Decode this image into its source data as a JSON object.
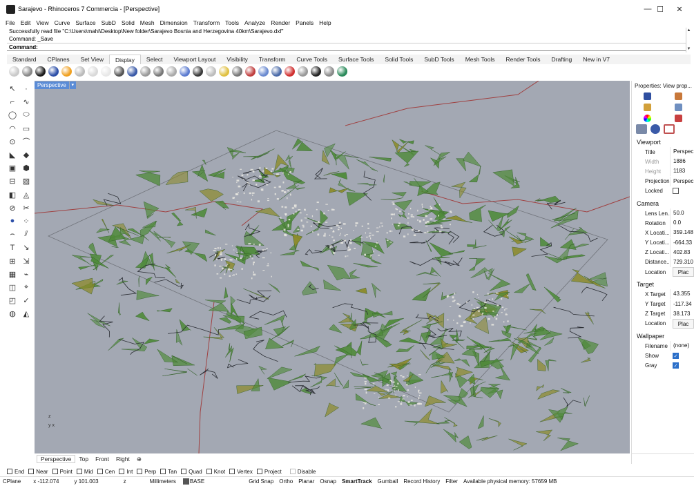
{
  "window": {
    "title": "Sarajevo - Rhinoceros 7 Commercia - [Perspective]",
    "minimize": "—",
    "maximize": "☐",
    "close": "✕"
  },
  "menu": [
    "File",
    "Edit",
    "View",
    "Curve",
    "Surface",
    "SubD",
    "Solid",
    "Mesh",
    "Dimension",
    "Transform",
    "Tools",
    "Analyze",
    "Render",
    "Panels",
    "Help"
  ],
  "command": {
    "history1": "Successfully read file \"C:\\Users\\mahi\\Desktop\\New folder\\Sarajevo Bosnia and Herzegovina 40km\\Sarajevo.dxf\"",
    "history2": "Command: _Save",
    "prompt": "Command:",
    "scroll_up": "▲",
    "scroll_down": "▼"
  },
  "toolbar_tabs": [
    "Standard",
    "CPlanes",
    "Set View",
    "Display",
    "Select",
    "Viewport Layout",
    "Visibility",
    "Transform",
    "Curve Tools",
    "Surface Tools",
    "Solid Tools",
    "SubD Tools",
    "Mesh Tools",
    "Render Tools",
    "Drafting",
    "New in V7"
  ],
  "active_tab_index": 3,
  "viewport": {
    "name": "Perspective",
    "dropdown": "▾",
    "axis_z": "z",
    "axis_x": "x",
    "axis_y": "y"
  },
  "view_tabs": [
    "Perspective",
    "Top",
    "Front",
    "Right"
  ],
  "view_tab_add": "⊕",
  "properties": {
    "header": "Properties: View prop...",
    "viewport_section": "Viewport",
    "title_label": "Title",
    "title_value": "Perspec",
    "width_label": "Width",
    "width_value": "1886",
    "height_label": "Height",
    "height_value": "1183",
    "projection_label": "Projection",
    "projection_value": "Perspec",
    "locked_label": "Locked",
    "camera_section": "Camera",
    "lens_label": "Lens Len...",
    "lens_value": "50.0",
    "rotation_label": "Rotation",
    "rotation_value": "0.0",
    "xloc_label": "X Locati...",
    "xloc_value": "359.148",
    "yloc_label": "Y Locati...",
    "yloc_value": "-664.33",
    "zloc_label": "Z Locati...",
    "zloc_value": "402.83",
    "dist_label": "Distance...",
    "dist_value": "729.310",
    "loc_label": "Location",
    "loc_button": "Plac",
    "target_section": "Target",
    "xt_label": "X Target",
    "xt_value": "43.355",
    "yt_label": "Y Target",
    "yt_value": "-117.34",
    "zt_label": "Z Target",
    "zt_value": "38.173",
    "tloc_label": "Location",
    "tloc_button": "Plac",
    "wallpaper_section": "Wallpaper",
    "filename_label": "Filename",
    "filename_value": "(none)",
    "show_label": "Show",
    "show_checked": true,
    "gray_label": "Gray",
    "gray_checked": true
  },
  "osnaps": [
    "End",
    "Near",
    "Point",
    "Mid",
    "Cen",
    "Int",
    "Perp",
    "Tan",
    "Quad",
    "Knot",
    "Vertex",
    "Project",
    "Disable"
  ],
  "status": {
    "cplane": "CPlane",
    "x": "x -112.074",
    "y": "y 101.003",
    "z": "z",
    "units": "Millimeters",
    "layer": "BASE",
    "grid_snap": "Grid Snap",
    "ortho": "Ortho",
    "planar": "Planar",
    "osnap": "Osnap",
    "smarttrack": "SmartTrack",
    "gumball": "Gumball",
    "record_history": "Record History",
    "filter": "Filter",
    "memory": "Available physical memory: 57659 MB"
  },
  "colors": {
    "viewport_bg": "#a3a8b3",
    "terrain_green": "#4f8a3a",
    "terrain_olive": "#8c8a2a",
    "road_dark": "#2a2d33",
    "boundary_red": "#a04040",
    "urban_white": "#e8e6df",
    "active_label": "#5b8cd6"
  },
  "left_tool_icons": [
    "select-arrow-icon",
    "point-icon",
    "polyline-icon",
    "curve-icon",
    "circle-icon",
    "ellipse-icon",
    "arc-icon",
    "rectangle-icon",
    "circle-center-icon",
    "fillet-icon",
    "surface-icon",
    "sweep-icon",
    "box-icon",
    "boolean-icon",
    "cylinder-icon",
    "mesh-icon",
    "extrude-icon",
    "solid-edit-icon",
    "split-icon",
    "trim-icon",
    "blue-sphere-icon",
    "array-icon",
    "fillet-curve-icon",
    "offset-icon",
    "text-icon",
    "dimension-icon",
    "group-icon",
    "transform-icon",
    "block-icon",
    "measure-icon",
    "layer-icon",
    "analyze-icon",
    "copy-icon",
    "check-icon",
    "render-icon",
    "material-icon"
  ],
  "toolbar_icons": [
    "wireframe-icon",
    "shaded-icon",
    "rendered-icon",
    "ghosted-icon",
    "material-sphere-icon",
    "xray-icon",
    "technical-icon",
    "artistic-icon",
    "pen-icon",
    "display-mode-icon",
    "clipping-icon",
    "camera-lock-icon",
    "isolate-icon",
    "zebra-icon",
    "environment-icon",
    "curvature-icon",
    "gold-sphere-icon",
    "section-icon",
    "draft-angle-icon",
    "emap-icon",
    "object-settings-icon",
    "hide-icon",
    "lock-icon",
    "monitor-icon",
    "capture-icon",
    "print-display-icon"
  ]
}
